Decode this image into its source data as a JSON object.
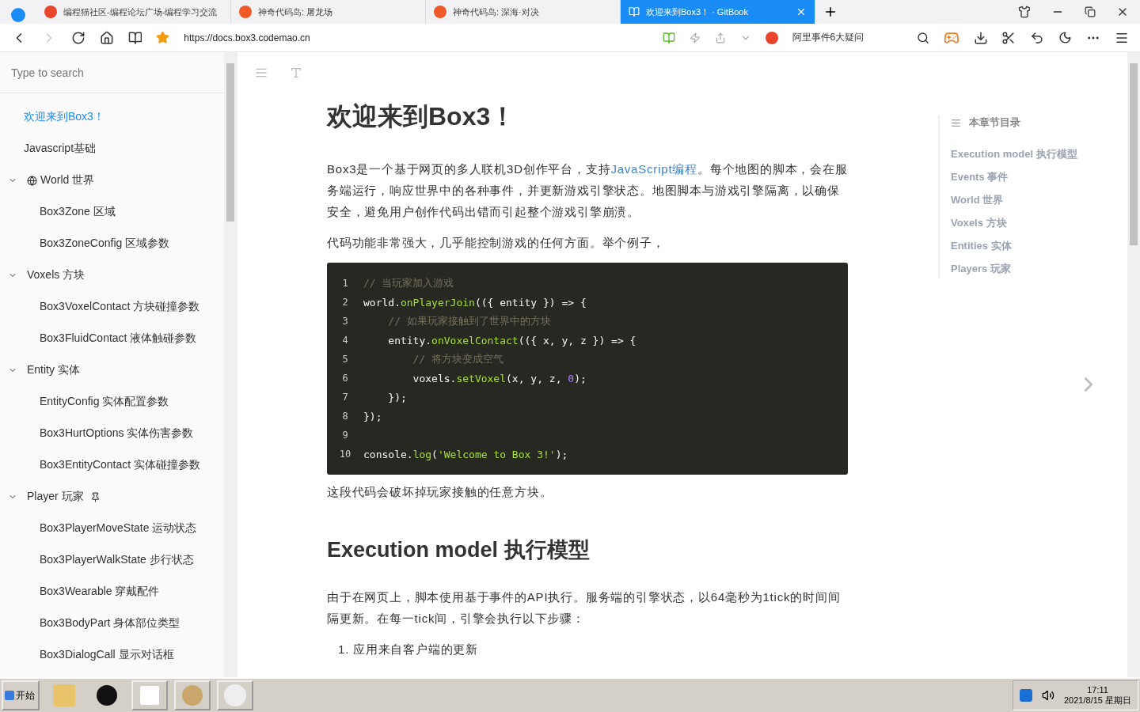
{
  "browser_tabs": [
    {
      "title": "编程猫社区-编程论坛广场-编程学习交流",
      "selected": false
    },
    {
      "title": "神奇代码岛: 屠龙场",
      "selected": false
    },
    {
      "title": "神奇代码岛: 深海·对决",
      "selected": false
    },
    {
      "title": "欢迎来到Box3！ · GitBook",
      "selected": true
    }
  ],
  "address": {
    "url": "https://docs.box3.codemao.cn",
    "search_hint": "阿里事件6大疑问"
  },
  "sidebar": {
    "search": {
      "placeholder": "Type to search"
    },
    "items": [
      {
        "label": "欢迎来到Box3！",
        "selected": true
      },
      {
        "label": "Javascript基础",
        "selected": false
      },
      {
        "label": "World 世界",
        "selected": false,
        "expanded": true,
        "children": [
          {
            "label": "Box3Zone 区域",
            "selected": false
          },
          {
            "label": "Box3ZoneConfig 区域参数",
            "selected": false
          }
        ]
      },
      {
        "label": "Voxels 方块",
        "selected": false,
        "expanded": true,
        "children": [
          {
            "label": "Box3VoxelContact 方块碰撞参数",
            "selected": false
          },
          {
            "label": "Box3FluidContact 液体触碰参数",
            "selected": false
          }
        ]
      },
      {
        "label": "Entity 实体",
        "selected": false,
        "expanded": true,
        "children": [
          {
            "label": "EntityConfig 实体配置参数",
            "selected": false
          },
          {
            "label": "Box3HurtOptions 实体伤害参数",
            "selected": false
          },
          {
            "label": "Box3EntityContact 实体碰撞参数",
            "selected": false
          }
        ]
      },
      {
        "label": "Player 玩家",
        "selected": false,
        "expanded": true,
        "children": [
          {
            "label": "Box3PlayerMoveState 运动状态",
            "selected": false
          },
          {
            "label": "Box3PlayerWalkState 步行状态",
            "selected": false
          },
          {
            "label": "Box3Wearable 穿戴配件",
            "selected": false
          },
          {
            "label": "Box3BodyPart 身体部位类型",
            "selected": false
          },
          {
            "label": "Box3DialogCall 显示对话框",
            "selected": false
          }
        ]
      }
    ]
  },
  "article": {
    "title": "欢迎来到Box3！",
    "intro": {
      "before": "Box3是一个基于网页的多人联机3D创作平台，支持",
      "link": "JavaScript编程",
      "after": "。每个地图的脚本，会在服务端运行，响应世界中的各种事件，并更新游戏引擎状态。地图脚本与游戏引擎隔离，以确保安全，避免用户创作代码出错而引起整个游戏引擎崩溃。"
    },
    "paragraph_2": "代码功能非常强大，几乎能控制游戏的任何方面。举个例子，",
    "code": [
      {
        "n": "1",
        "parts": [
          {
            "t": "// 当玩家加入游戏",
            "kind": "comment"
          }
        ]
      },
      {
        "n": "2",
        "parts": [
          {
            "t": "world.",
            "kind": "plain"
          },
          {
            "t": "onPlayerJoin",
            "kind": "function"
          },
          {
            "t": "(({ entity }) => {",
            "kind": "plain"
          }
        ]
      },
      {
        "n": "3",
        "parts": [
          {
            "t": "    // 如果玩家接触到了世界中的方块",
            "kind": "comment"
          }
        ]
      },
      {
        "n": "4",
        "parts": [
          {
            "t": "    entity.",
            "kind": "plain"
          },
          {
            "t": "onVoxelContact",
            "kind": "function"
          },
          {
            "t": "(({ x, y, z }) => {",
            "kind": "plain"
          }
        ]
      },
      {
        "n": "5",
        "parts": [
          {
            "t": "        // 将方块变成空气",
            "kind": "comment"
          }
        ]
      },
      {
        "n": "6",
        "parts": [
          {
            "t": "        voxels.",
            "kind": "plain"
          },
          {
            "t": "setVoxel",
            "kind": "function"
          },
          {
            "t": "(x, y, z, ",
            "kind": "plain"
          },
          {
            "t": "0",
            "kind": "number"
          },
          {
            "t": ");",
            "kind": "plain"
          }
        ]
      },
      {
        "n": "7",
        "parts": [
          {
            "t": "    });",
            "kind": "plain"
          }
        ]
      },
      {
        "n": "8",
        "parts": [
          {
            "t": "});",
            "kind": "plain"
          }
        ]
      },
      {
        "n": "9"
      },
      {
        "n": "10",
        "parts": [
          {
            "t": "console.",
            "kind": "plain"
          },
          {
            "t": "log",
            "kind": "function"
          },
          {
            "t": "(",
            "kind": "plain"
          },
          {
            "t": "'Welcome to Box 3!'",
            "kind": "string"
          },
          {
            "t": ");",
            "kind": "plain"
          }
        ]
      }
    ],
    "after_code": "这段代码会破坏掉玩家接触的任意方块。",
    "section_title": "Execution model 执行模型",
    "section_text": "由于在网页上，脚本使用基于事件的API执行。服务端的引擎状态，以64毫秒为1tick的时间间隔更新。在每一tick间，引擎会执行以下步骤：",
    "steps": [
      "1. 应用来自客户端的更新"
    ]
  },
  "toc": {
    "title": "本章节目录",
    "items": [
      "Execution model 执行模型",
      "Events 事件",
      "World 世界",
      "Voxels 方块",
      "Entities 实体",
      "Players 玩家"
    ]
  },
  "taskbar": {
    "start": "开始",
    "time": "17:11",
    "date": "2021/8/15 星期日"
  }
}
